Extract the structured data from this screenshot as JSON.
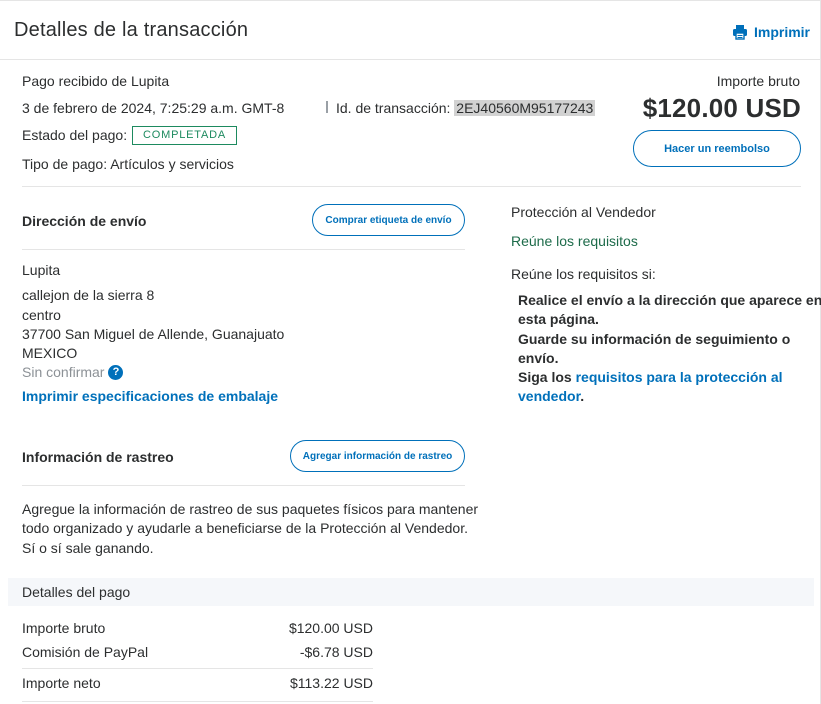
{
  "header": {
    "title": "Detalles de la transacción",
    "print_label": "Imprimir"
  },
  "summary": {
    "received_from": "Pago recibido de Lupita",
    "date": "3 de febrero de 2024, 7:25:29 a.m. GMT-8",
    "transaction_id_label": "Id. de transacción:",
    "transaction_id": "2EJ40560M95177243",
    "status_label": "Estado del pago:",
    "status_value": "COMPLETADA",
    "payment_type": "Tipo de pago: Artículos y servicios",
    "gross_label": "Importe bruto",
    "gross_amount": "$120.00 USD",
    "refund_button": "Hacer un reembolso"
  },
  "shipping": {
    "heading": "Dirección de envío",
    "buy_label_button": "Comprar etiqueta de envío",
    "name": "Lupita",
    "line1": "callejon de la sierra 8",
    "line2": "centro",
    "line3": "37700 San Miguel de Allende, Guanajuato",
    "country": "MEXICO",
    "unconfirmed": "Sin confirmar",
    "print_packing_link": "Imprimir especificaciones de embalaje"
  },
  "tracking": {
    "heading": "Información de rastreo",
    "add_button": "Agregar información de rastreo",
    "description_line1": "Agregue la información de rastreo de sus paquetes físicos para mantener",
    "description_line2": "todo organizado y ayudarle a beneficiarse de la Protección al Vendedor.",
    "description_line3": "Sí o sí sale ganando."
  },
  "seller_protection": {
    "title": "Protección al Vendedor",
    "status": "Reúne los requisitos",
    "intro": "Reúne los requisitos si:",
    "req1_line1": "Realice el envío a la dirección que aparece en",
    "req1_line2": "esta página.",
    "req2_line1": "Guarde su información de seguimiento o",
    "req2_line2": "envío.",
    "req3_prefix": "Siga los ",
    "req3_link_line1": "requisitos para la protección al",
    "req3_link_line2": "vendedor",
    "req3_suffix": "."
  },
  "payment_details": {
    "heading": "Detalles del pago",
    "rows": [
      {
        "label": "Importe bruto",
        "value": "$120.00 USD"
      },
      {
        "label": "Comisión de PayPal",
        "value": "-$6.78 USD"
      },
      {
        "label": "Importe neto",
        "value": "$113.22 USD"
      }
    ]
  },
  "colors": {
    "accent": "#0070ba",
    "status_green": "#1d8a5f",
    "text": "#2c2e2f"
  },
  "icons": {
    "print": "printer-icon",
    "help": "question-icon"
  }
}
